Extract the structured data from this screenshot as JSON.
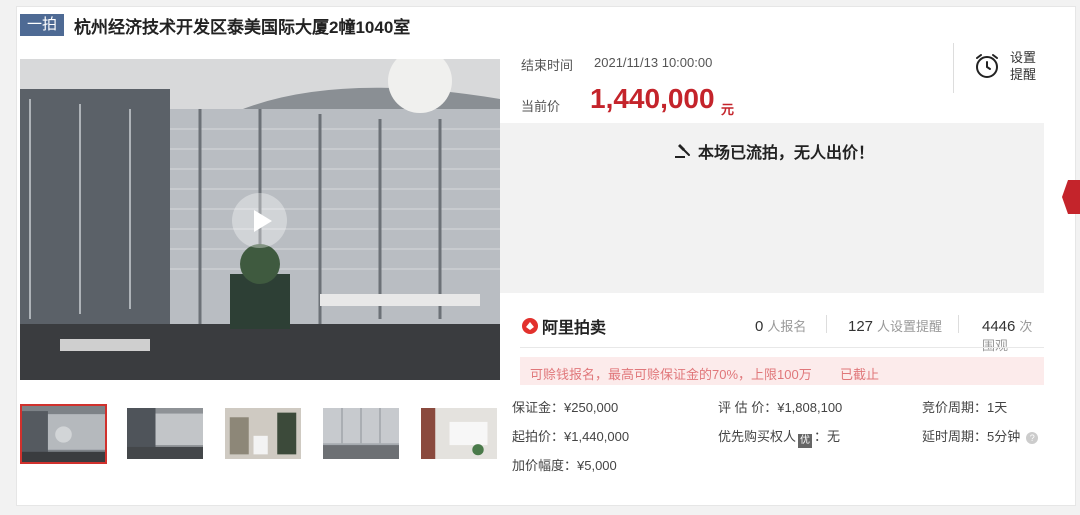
{
  "header": {
    "badge": "一拍",
    "title": "杭州经济技术开发区泰美国际大厦2幢1040室"
  },
  "auction": {
    "end_time_label": "结束时间",
    "end_time_value": "2021/11/13 10:00:00",
    "current_price_label": "当前价",
    "current_price_value": "1,440,000",
    "current_price_unit": "元",
    "remind_label": "设置提醒",
    "status_message": "本场已流拍，无人出价！"
  },
  "platform": {
    "name": "阿里拍卖"
  },
  "stats": [
    {
      "count": "0",
      "label": "人报名"
    },
    {
      "count": "127",
      "label": "人设置提醒"
    },
    {
      "count": "4446",
      "label": "次围观"
    }
  ],
  "notice": {
    "text": "可赊钱报名，最高可赊保证金的70%，上限100万",
    "status": "已截止"
  },
  "details": {
    "deposit": "保证金：¥250,000",
    "appraisal": "评 估 价：¥1,808,100",
    "period": "竞价周期：1天",
    "start_price": "起拍价：¥1,440,000",
    "priority_label": "优先购买权人",
    "priority_icon_text": "优",
    "priority_value": "：无",
    "delay": "延时周期：5分钟",
    "increment": "加价幅度：¥5,000"
  },
  "media": {
    "thumbnail_count": 5,
    "active_thumbnail": 1
  },
  "colors": {
    "accent_red": "#c4242b",
    "badge_blue": "#4e6a94",
    "notice_bg": "#fcebeb",
    "notice_text": "#e0777a"
  }
}
